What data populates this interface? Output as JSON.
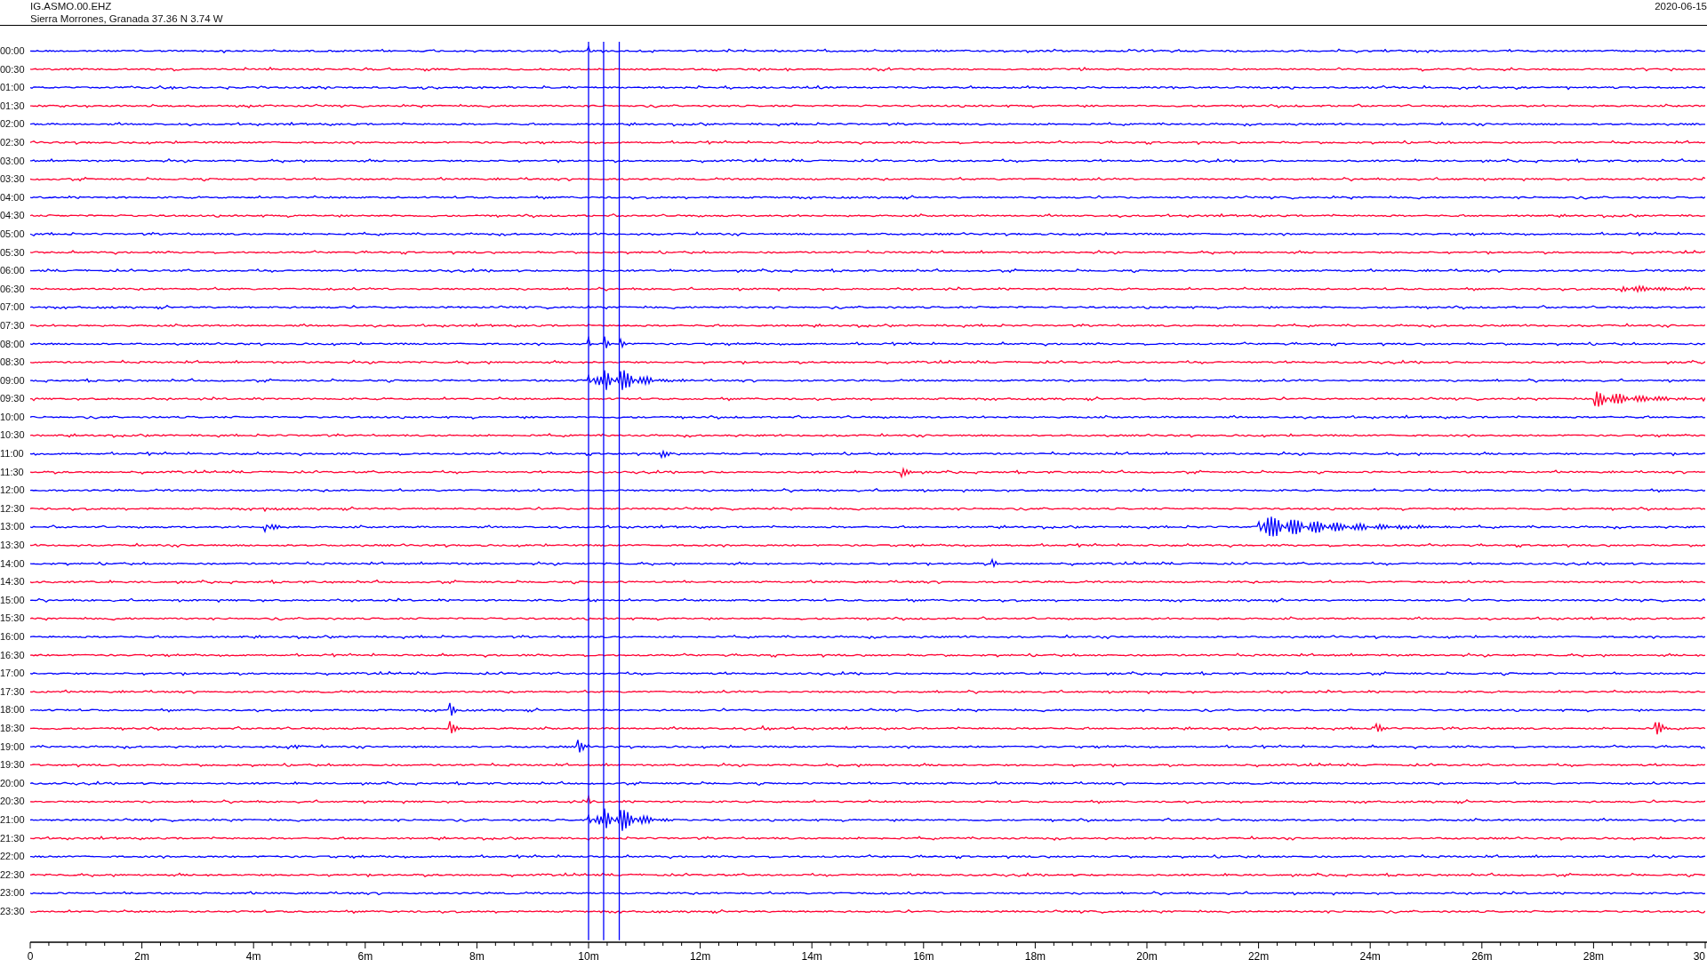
{
  "header": {
    "station": "IG.ASMO.00.EHZ",
    "location": "Sierra Morrones, Granada  37.36 N 3.74 W",
    "date": "2020-06-15"
  },
  "rows": [
    {
      "label": "00:00",
      "color": "#0000ff"
    },
    {
      "label": "00:30",
      "color": "#ff0033"
    },
    {
      "label": "01:00",
      "color": "#0000ff"
    },
    {
      "label": "01:30",
      "color": "#ff0033"
    },
    {
      "label": "02:00",
      "color": "#0000ff"
    },
    {
      "label": "02:30",
      "color": "#ff0033"
    },
    {
      "label": "03:00",
      "color": "#0000ff"
    },
    {
      "label": "03:30",
      "color": "#ff0033"
    },
    {
      "label": "04:00",
      "color": "#0000ff"
    },
    {
      "label": "04:30",
      "color": "#ff0033"
    },
    {
      "label": "05:00",
      "color": "#0000ff"
    },
    {
      "label": "05:30",
      "color": "#ff0033"
    },
    {
      "label": "06:00",
      "color": "#0000ff"
    },
    {
      "label": "06:30",
      "color": "#ff0033"
    },
    {
      "label": "07:00",
      "color": "#0000ff"
    },
    {
      "label": "07:30",
      "color": "#ff0033"
    },
    {
      "label": "08:00",
      "color": "#0000ff"
    },
    {
      "label": "08:30",
      "color": "#ff0033"
    },
    {
      "label": "09:00",
      "color": "#0000ff"
    },
    {
      "label": "09:30",
      "color": "#ff0033"
    },
    {
      "label": "10:00",
      "color": "#0000ff"
    },
    {
      "label": "10:30",
      "color": "#ff0033"
    },
    {
      "label": "11:00",
      "color": "#0000ff"
    },
    {
      "label": "11:30",
      "color": "#ff0033"
    },
    {
      "label": "12:00",
      "color": "#0000ff"
    },
    {
      "label": "12:30",
      "color": "#ff0033"
    },
    {
      "label": "13:00",
      "color": "#0000ff"
    },
    {
      "label": "13:30",
      "color": "#ff0033"
    },
    {
      "label": "14:00",
      "color": "#0000ff"
    },
    {
      "label": "14:30",
      "color": "#ff0033"
    },
    {
      "label": "15:00",
      "color": "#0000ff"
    },
    {
      "label": "15:30",
      "color": "#ff0033"
    },
    {
      "label": "16:00",
      "color": "#0000ff"
    },
    {
      "label": "16:30",
      "color": "#ff0033"
    },
    {
      "label": "17:00",
      "color": "#0000ff"
    },
    {
      "label": "17:30",
      "color": "#ff0033"
    },
    {
      "label": "18:00",
      "color": "#0000ff"
    },
    {
      "label": "18:30",
      "color": "#ff0033"
    },
    {
      "label": "19:00",
      "color": "#0000ff"
    },
    {
      "label": "19:30",
      "color": "#ff0033"
    },
    {
      "label": "20:00",
      "color": "#0000ff"
    },
    {
      "label": "20:30",
      "color": "#ff0033"
    },
    {
      "label": "21:00",
      "color": "#0000ff"
    },
    {
      "label": "21:30",
      "color": "#ff0033"
    },
    {
      "label": "22:00",
      "color": "#0000ff"
    },
    {
      "label": "22:30",
      "color": "#ff0033"
    },
    {
      "label": "23:00",
      "color": "#0000ff"
    },
    {
      "label": "23:30",
      "color": "#ff0033"
    }
  ],
  "x_axis": {
    "labels": [
      "0",
      "2m",
      "4m",
      "6m",
      "8m",
      "10m",
      "12m",
      "14m",
      "16m",
      "18m",
      "20m",
      "22m",
      "24m",
      "26m",
      "28m",
      "30"
    ]
  }
}
